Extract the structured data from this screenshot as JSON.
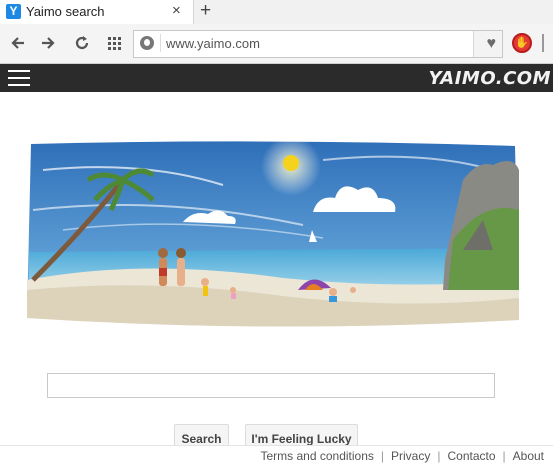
{
  "browser": {
    "tab_favicon": "Y",
    "tab_title": "Yaimo search",
    "tab_close": "×",
    "new_tab": "+",
    "address": "www.yaimo.com",
    "icons": [
      "back-icon",
      "forward-icon",
      "reload-icon",
      "apps-icon",
      "globe-icon",
      "heart-icon",
      "stop-extension-icon"
    ]
  },
  "site": {
    "brand": "YAIMO.COM",
    "search_placeholder": "",
    "search_button": "Search",
    "lucky_button": "I'm Feeling Lucky",
    "footer": {
      "terms": "Terms and conditions",
      "privacy": "Privacy",
      "contact": "Contacto",
      "about": "About",
      "separator": "|"
    }
  },
  "colors": {
    "header_bg": "#2b2b2b",
    "sky": "#3d7fc4",
    "sea": "#3f9ed1",
    "sand": "#e9e1cf",
    "sun": "#f5d21c"
  }
}
